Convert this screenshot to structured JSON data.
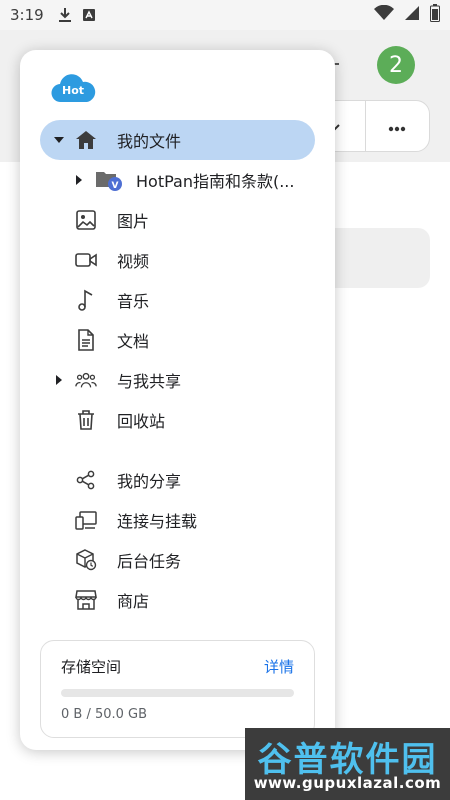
{
  "status_bar": {
    "time": "3:19"
  },
  "background": {
    "badge_count": "2"
  },
  "drawer": {
    "logo_text": "Hot",
    "items": [
      {
        "label": "我的文件",
        "icon": "home-icon"
      },
      {
        "label": "HotPan指南和条款(...",
        "icon": "shared-folder-icon",
        "badge": "V"
      },
      {
        "label": "图片",
        "icon": "image-icon"
      },
      {
        "label": "视频",
        "icon": "video-icon"
      },
      {
        "label": "音乐",
        "icon": "music-icon"
      },
      {
        "label": "文档",
        "icon": "document-icon"
      },
      {
        "label": "与我共享",
        "icon": "people-icon"
      },
      {
        "label": "回收站",
        "icon": "trash-icon"
      },
      {
        "label": "我的分享",
        "icon": "share-icon"
      },
      {
        "label": "连接与挂载",
        "icon": "devices-icon"
      },
      {
        "label": "后台任务",
        "icon": "box-task-icon"
      },
      {
        "label": "商店",
        "icon": "store-icon"
      }
    ]
  },
  "storage": {
    "title": "存储空间",
    "details_label": "详情",
    "usage_text": "0 B / 50.0 GB",
    "used_fraction": 0
  },
  "watermark": {
    "title": "谷普软件园",
    "url": "www.gupuxlazal.com"
  },
  "colors": {
    "accent": "#1a73e8",
    "selected_bg": "#bcd6f3",
    "badge_green": "#5cad58",
    "logo_blue": "#2d9be0"
  }
}
